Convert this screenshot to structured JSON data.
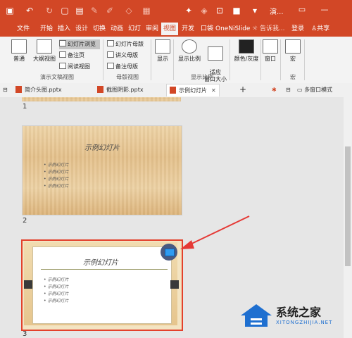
{
  "app": {
    "doc_title": "演...",
    "restore_symbol": "▭",
    "minimize_symbol": "—"
  },
  "tabs": [
    "文件",
    "开始",
    "插入",
    "设计",
    "切换",
    "动画",
    "幻灯",
    "审阅",
    "视图",
    "开发",
    "口袋",
    "OneN",
    "iSlide"
  ],
  "active_tab": "视图",
  "tell_me": "告诉我...",
  "login": "登录",
  "share": "共享",
  "ribbon": {
    "normal": "普通",
    "outline": "大纲视图",
    "sorter": "幻灯片浏览",
    "notes_page": "备注页",
    "reading": "阅读视图",
    "group_views": "演示文稿视图",
    "slide_master": "幻灯片母版",
    "handout_master": "讲义母版",
    "notes_master": "备注母版",
    "group_master": "母版视图",
    "show": "显示",
    "zoom": "显示比例",
    "fit_window": "适应\n窗口大小",
    "group_zoom": "显示比例",
    "color": "颜色/灰度",
    "window": "窗口",
    "macros": "宏",
    "group_macros": "宏"
  },
  "doc_tabs": [
    "简介头图.pptx",
    "截图阴影.pptx",
    "示例幻灯片"
  ],
  "doc_tab_close": "✕",
  "doc_tab_add": "+",
  "multi_window": "多窗口模式",
  "slides": [
    {
      "number": "1"
    },
    {
      "number": "2",
      "title": "示例幻灯片",
      "bullets": [
        "示例幻灯片",
        "示例幻灯片",
        "示例幻灯片",
        "示例幻灯片"
      ]
    },
    {
      "number": "3",
      "title": "示例幻灯片",
      "bullets": [
        "示例幻灯片",
        "示例幻灯片",
        "示例幻灯片",
        "示例幻灯片"
      ]
    }
  ],
  "watermark": {
    "name": "系统之家",
    "url": "XITONGZHIJIA.NET"
  },
  "colors": {
    "accent": "#d24726",
    "selection": "#e3412c",
    "arrow": "#e53935"
  }
}
